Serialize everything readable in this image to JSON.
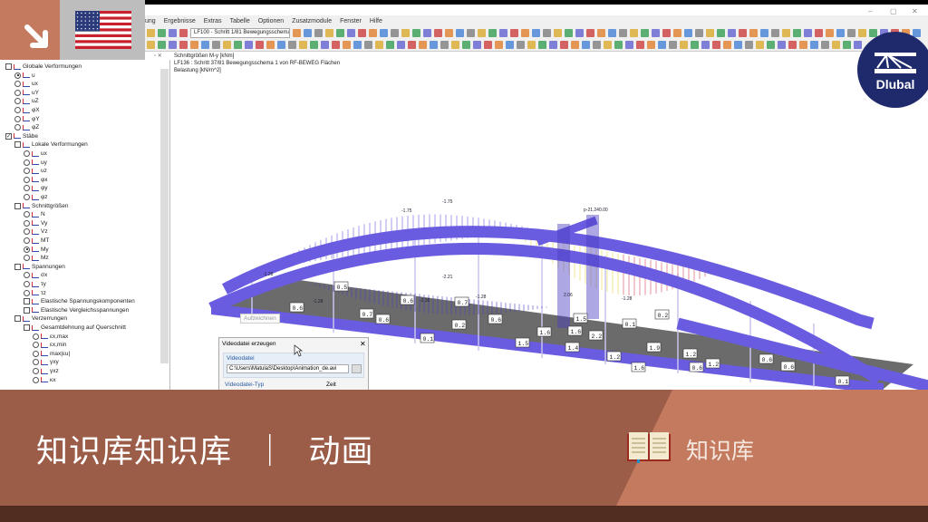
{
  "window": {
    "min": "–",
    "max": "▢",
    "close": "✕"
  },
  "menu": [
    "ung",
    "Ergebnisse",
    "Extras",
    "Tabelle",
    "Optionen",
    "Zusatzmodule",
    "Fenster",
    "Hilfe"
  ],
  "toolbar": {
    "loadcase": "LF100 - Schritt 1/81 Bewegungsschema"
  },
  "panel": {
    "controls": "▫ ✕",
    "tree": [
      {
        "label": "Globale Verformungen",
        "lvl": 0,
        "type": "chk"
      },
      {
        "label": "u",
        "lvl": 1,
        "type": "rad",
        "on": true
      },
      {
        "label": "ux",
        "lvl": 1,
        "type": "rad"
      },
      {
        "label": "uY",
        "lvl": 1,
        "type": "rad"
      },
      {
        "label": "uZ",
        "lvl": 1,
        "type": "rad"
      },
      {
        "label": "φX",
        "lvl": 1,
        "type": "rad"
      },
      {
        "label": "φY",
        "lvl": 1,
        "type": "rad"
      },
      {
        "label": "φZ",
        "lvl": 1,
        "type": "rad"
      },
      {
        "label": "Stäbe",
        "lvl": 0,
        "type": "chk",
        "checked": true
      },
      {
        "label": "Lokale Verformungen",
        "lvl": 1,
        "type": "chk"
      },
      {
        "label": "ux",
        "lvl": 2,
        "type": "rad"
      },
      {
        "label": "uy",
        "lvl": 2,
        "type": "rad"
      },
      {
        "label": "uz",
        "lvl": 2,
        "type": "rad"
      },
      {
        "label": "φx",
        "lvl": 2,
        "type": "rad"
      },
      {
        "label": "φy",
        "lvl": 2,
        "type": "rad"
      },
      {
        "label": "φz",
        "lvl": 2,
        "type": "rad"
      },
      {
        "label": "Schnittgrößen",
        "lvl": 1,
        "type": "chk"
      },
      {
        "label": "N",
        "lvl": 2,
        "type": "rad"
      },
      {
        "label": "Vy",
        "lvl": 2,
        "type": "rad"
      },
      {
        "label": "Vz",
        "lvl": 2,
        "type": "rad"
      },
      {
        "label": "MT",
        "lvl": 2,
        "type": "rad"
      },
      {
        "label": "My",
        "lvl": 2,
        "type": "rad",
        "on": true
      },
      {
        "label": "Mz",
        "lvl": 2,
        "type": "rad"
      },
      {
        "label": "Spannungen",
        "lvl": 1,
        "type": "chk"
      },
      {
        "label": "σx",
        "lvl": 2,
        "type": "rad"
      },
      {
        "label": "τy",
        "lvl": 2,
        "type": "rad"
      },
      {
        "label": "τz",
        "lvl": 2,
        "type": "rad"
      },
      {
        "label": "Elastische Spannungskomponenten",
        "lvl": 2,
        "type": "chk"
      },
      {
        "label": "Elastische Vergleichsspannungen",
        "lvl": 2,
        "type": "chk"
      },
      {
        "label": "Verzerrungen",
        "lvl": 1,
        "type": "chk"
      },
      {
        "label": "Gesamtdehnung auf Querschnitt",
        "lvl": 2,
        "type": "chk"
      },
      {
        "label": "εx,max",
        "lvl": 3,
        "type": "rad"
      },
      {
        "label": "εx,min",
        "lvl": 3,
        "type": "rad"
      },
      {
        "label": "max|εu|",
        "lvl": 3,
        "type": "rad"
      },
      {
        "label": "γxy",
        "lvl": 3,
        "type": "rad"
      },
      {
        "label": "γxz",
        "lvl": 3,
        "type": "rad"
      },
      {
        "label": "κx",
        "lvl": 3,
        "type": "rad"
      }
    ]
  },
  "view": {
    "line1": "Schnittgrößen M-y [kNm]",
    "line2": "LF136 : Schritt 37/81 Bewegungsschema 1 von RF-BEWEG Flächen",
    "line3": "Belastung [kN/m^2]",
    "record_button": "Aufzeichnen",
    "top_labels": [
      "-1.75",
      "-1.75",
      "-2.21",
      "-2.35",
      "-1.28",
      "-1.28",
      "-1.28",
      "-1.28",
      "2.06",
      "p-21.240.00"
    ],
    "value_labels": [
      "0.6",
      "0.5",
      "0.5",
      "0.7",
      "0.6",
      "0.7",
      "0.6",
      "0.6",
      "0.5",
      "0.1",
      "0.1",
      "0.2",
      "0.2",
      "1.6",
      "1.5",
      "1.6",
      "2.2",
      "1.5",
      "1.4",
      "1.9",
      "1.6",
      "1.2",
      "1.2",
      "1.2",
      "0.6",
      "0.6",
      "0.6",
      "0.1"
    ]
  },
  "dialog": {
    "title": "Videodatei erzeugen",
    "close": "✕",
    "section": "Videodatei",
    "path": "C:\\Users\\MatulaS\\Desktop\\Animation_de.avi",
    "type_label": "Videodatei-Typ",
    "time_label": "Zeit"
  },
  "logo": {
    "text": "Dlubal"
  },
  "banner": {
    "title": "知识库知识库  ｜  动画",
    "category": "知识库"
  },
  "colors": {
    "banner": "#c47a5e",
    "banner_dark": "#9b5c48",
    "footer": "#512c20",
    "arch": "#6a5ce0",
    "logo": "#1f2a6d"
  }
}
